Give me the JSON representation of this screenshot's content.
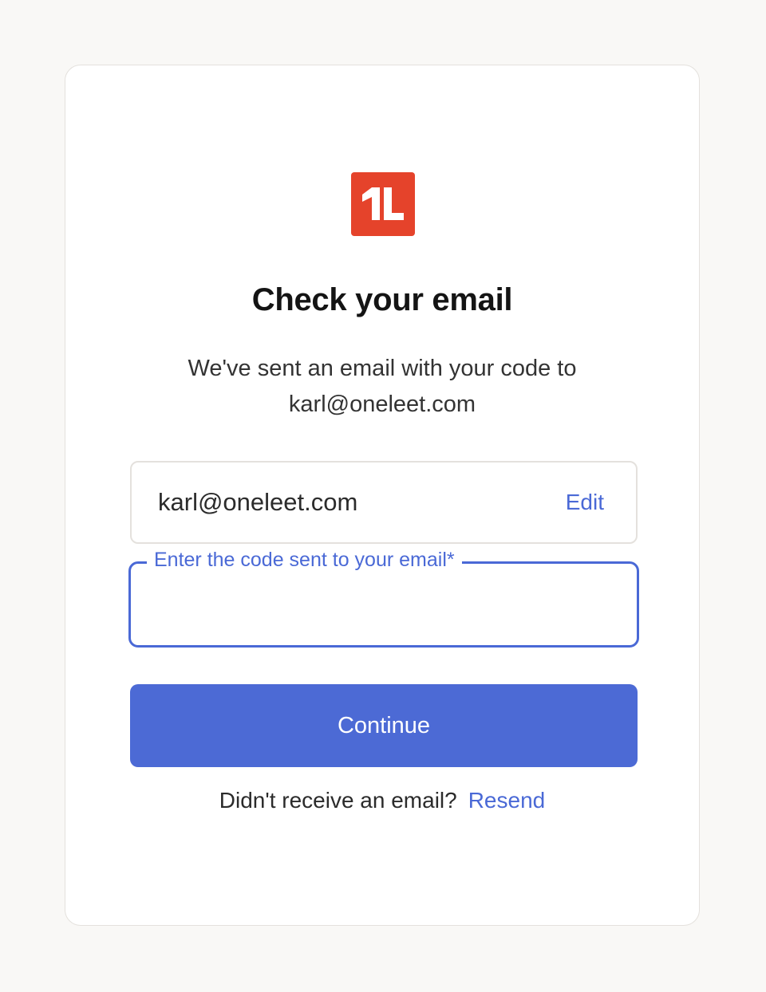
{
  "brand": {
    "logo_icon": "oneleet-1l-logo-icon",
    "color": "#e5432b"
  },
  "page": {
    "title": "Check your email",
    "subtitle_line1": "We've sent an email with your code to",
    "subtitle_line2": "karl@oneleet.com"
  },
  "email_field": {
    "value": "karl@oneleet.com",
    "edit_label": "Edit"
  },
  "code_field": {
    "label": "Enter the code sent to your email*",
    "value": "",
    "placeholder": ""
  },
  "actions": {
    "continue_label": "Continue",
    "resend_prompt": "Didn't receive an email?",
    "resend_label": "Resend"
  },
  "colors": {
    "accent": "#4c6ad5",
    "link": "#4a69d6",
    "background": "#f9f8f6",
    "card": "#ffffff"
  }
}
